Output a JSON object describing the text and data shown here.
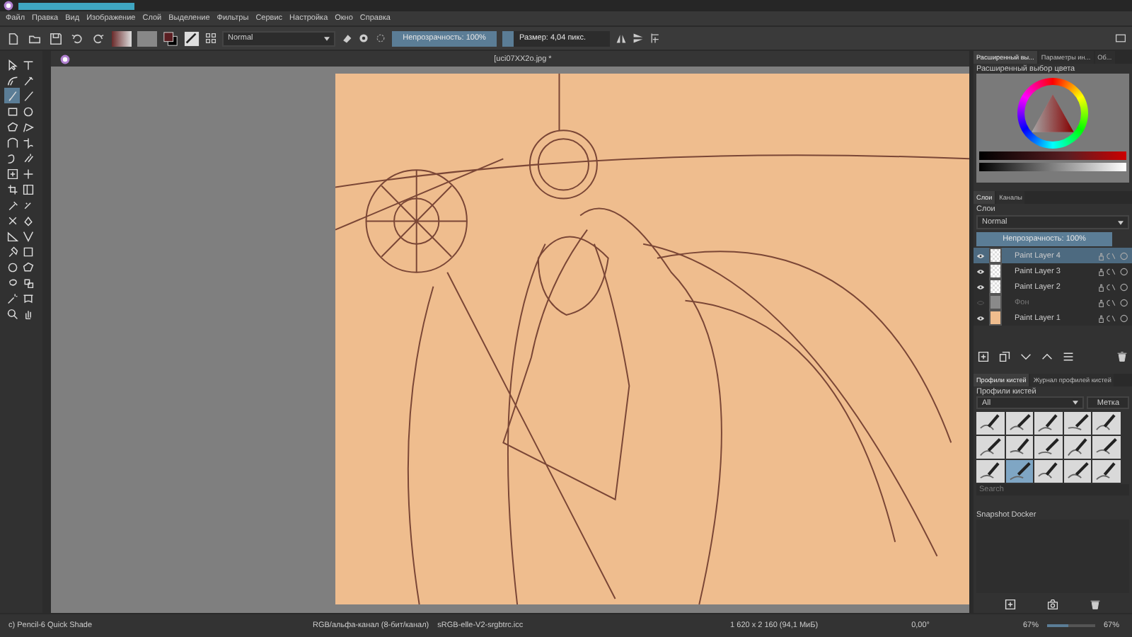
{
  "menu": [
    "Файл",
    "Правка",
    "Вид",
    "Изображение",
    "Слой",
    "Выделение",
    "Фильтры",
    "Сервис",
    "Настройка",
    "Окно",
    "Справка"
  ],
  "toolbar": {
    "blend_mode": "Normal",
    "opacity": {
      "label": "Непрозрачность: 100%",
      "level": 1
    },
    "size": {
      "label": "Размер: 4,04 пикс.",
      "level": 0.1
    }
  },
  "toolbox": {
    "tools": [
      {
        "selected": false
      },
      {
        "selected": false
      },
      {
        "selected": false
      },
      {
        "selected": false
      },
      {
        "selected": true
      },
      {
        "selected": false
      },
      {
        "selected": false
      },
      {
        "selected": false
      },
      {
        "selected": false
      },
      {
        "selected": false
      },
      {
        "selected": false
      },
      {
        "selected": false
      },
      {
        "selected": false
      },
      {
        "selected": false
      },
      {
        "selected": false
      },
      {
        "selected": false
      },
      {
        "selected": false
      },
      {
        "selected": false
      },
      {
        "selected": false
      },
      {
        "selected": false
      },
      {
        "selected": false
      },
      {
        "selected": false
      },
      {
        "selected": false
      },
      {
        "selected": false
      },
      {
        "selected": false
      },
      {
        "selected": false
      },
      {
        "selected": false
      },
      {
        "selected": false
      },
      {
        "selected": false
      },
      {
        "selected": false
      },
      {
        "selected": false
      },
      {
        "selected": false
      },
      {
        "selected": false
      },
      {
        "selected": false
      }
    ]
  },
  "document": {
    "tab": "[uci07XX2o.jpg *"
  },
  "dock": {
    "tabs": [
      {
        "label": "Расширенный вы...",
        "selected": true
      },
      {
        "label": "Параметры ин...",
        "selected": false
      },
      {
        "label": "Об...",
        "selected": false
      }
    ],
    "color_selector": {
      "title": "Расширенный выбор цвета"
    },
    "layers": {
      "tabs": [
        {
          "label": "Слои",
          "selected": true
        },
        {
          "label": "Каналы",
          "selected": false
        }
      ],
      "title": "Слои",
      "blend_mode": "Normal",
      "opacity": {
        "label": "Непрозрачность: 100%",
        "level": 1
      },
      "items": [
        {
          "name": "Paint Layer 4",
          "visible": true,
          "selected": true
        },
        {
          "name": "Paint Layer 3",
          "visible": true,
          "selected": false
        },
        {
          "name": "Paint Layer 2",
          "visible": true,
          "selected": false
        },
        {
          "name": "Фон",
          "visible": false,
          "selected": false,
          "color": "#8a8a8a"
        },
        {
          "name": "Paint Layer 1",
          "visible": true,
          "selected": false,
          "color": "#efbd8e"
        }
      ]
    },
    "brushes": {
      "tabs": [
        {
          "label": "Профили кистей",
          "selected": true
        },
        {
          "label": "Журнал профилей кистей",
          "selected": false
        }
      ],
      "title": "Профили кистей",
      "tag_filter": "All",
      "tag_button": "Метка",
      "presets": [
        {
          "selected": false
        },
        {
          "selected": false
        },
        {
          "selected": false
        },
        {
          "selected": false
        },
        {
          "selected": false
        },
        {
          "selected": false
        },
        {
          "selected": false
        },
        {
          "selected": false
        },
        {
          "selected": false
        },
        {
          "selected": false
        },
        {
          "selected": false
        },
        {
          "selected": true
        },
        {
          "selected": false
        },
        {
          "selected": false
        },
        {
          "selected": false
        }
      ],
      "search": {
        "placeholder": "Search"
      }
    },
    "snapshot": {
      "title": "Snapshot Docker"
    },
    "zoom": {
      "label": "67%",
      "level": 0.45
    }
  },
  "status_bar": {
    "brush": "c) Pencil-6 Quick Shade",
    "color_space": "RGB/альфа-канал (8-бит/канал)",
    "profile": "sRGB-elle-V2-srgbtrc.icc",
    "size": "1 620 x 2 160 (94,1 МиБ)",
    "rotation": "0,00°",
    "zoom": "67%"
  }
}
